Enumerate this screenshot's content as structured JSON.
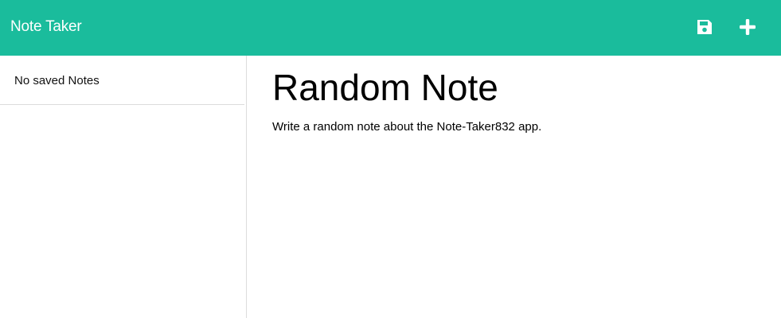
{
  "header": {
    "title": "Note Taker",
    "save_icon": "save-icon",
    "new_icon": "plus-icon",
    "color": "#1abc9c"
  },
  "sidebar": {
    "empty_message": "No saved Notes"
  },
  "note": {
    "title": "Random Note",
    "text": "Write a random note about the Note-Taker832 app."
  }
}
